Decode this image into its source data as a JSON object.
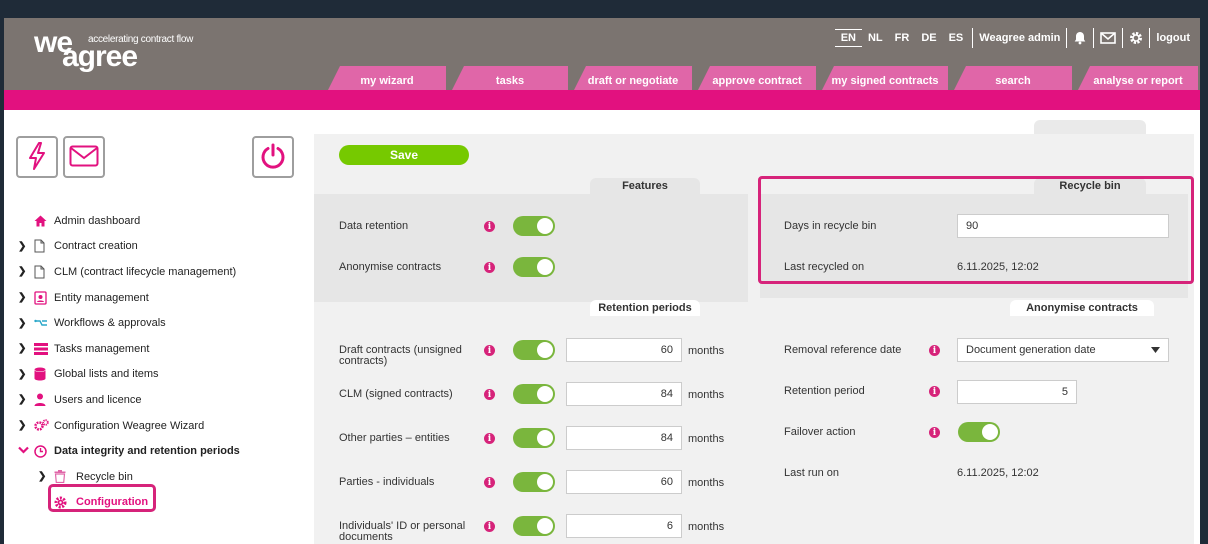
{
  "brand": {
    "we": "we",
    "agree": "agree",
    "tagline": "accelerating contract flow"
  },
  "languages": [
    {
      "code": "EN",
      "active": true
    },
    {
      "code": "NL",
      "active": false
    },
    {
      "code": "FR",
      "active": false
    },
    {
      "code": "DE",
      "active": false
    },
    {
      "code": "ES",
      "active": false
    }
  ],
  "user": {
    "name": "Weagree admin",
    "logout": "logout"
  },
  "nav_tabs": [
    "my wizard",
    "tasks",
    "draft or negotiate",
    "approve contract",
    "my signed contracts",
    "search",
    "analyse or report"
  ],
  "menu": [
    {
      "label": "Admin dashboard",
      "icon": "home-icon",
      "arrow": false
    },
    {
      "label": "Contract creation",
      "icon": "document-icon",
      "arrow": true
    },
    {
      "label": "CLM (contract lifecycle management)",
      "icon": "document-icon",
      "arrow": true
    },
    {
      "label": "Entity management",
      "icon": "contact-card-icon",
      "arrow": true
    },
    {
      "label": "Workflows & approvals",
      "icon": "workflow-icon",
      "arrow": true
    },
    {
      "label": "Tasks management",
      "icon": "list-icon",
      "arrow": true
    },
    {
      "label": "Global lists and items",
      "icon": "database-icon",
      "arrow": true
    },
    {
      "label": "Users and licence",
      "icon": "user-icon",
      "arrow": true
    },
    {
      "label": "Configuration Weagree Wizard",
      "icon": "gears-icon",
      "arrow": true
    },
    {
      "label": "Data integrity and retention periods",
      "icon": "clock-icon",
      "arrow": true,
      "expanded": true
    },
    {
      "label": "Recycle bin",
      "icon": "trash-icon",
      "arrow": true,
      "sub": true
    },
    {
      "label": "Configuration",
      "icon": "gear-icon",
      "arrow": false,
      "sub": true,
      "active": true
    }
  ],
  "save_label": "Save",
  "features": {
    "title": "Features",
    "rows": [
      {
        "label": "Data retention",
        "enabled": true
      },
      {
        "label": "Anonymise contracts",
        "enabled": true
      }
    ]
  },
  "retention": {
    "title": "Retention periods",
    "unit": "months",
    "rows": [
      {
        "label": "Draft contracts (unsigned contracts)",
        "value": "60",
        "enabled": true
      },
      {
        "label": "CLM (signed contracts)",
        "value": "84",
        "enabled": true
      },
      {
        "label": "Other parties – entities",
        "value": "84",
        "enabled": true
      },
      {
        "label": "Parties - individuals",
        "value": "60",
        "enabled": true
      },
      {
        "label": "Individuals' ID or personal documents",
        "value": "6",
        "enabled": true
      }
    ]
  },
  "recycle": {
    "title": "Recycle bin",
    "days_label": "Days in recycle bin",
    "days_value": "90",
    "last_label": "Last recycled on",
    "last_value": "6.11.2025, 12:02"
  },
  "anonymise": {
    "title": "Anonymise contracts",
    "ref_label": "Removal reference date",
    "ref_value": "Document generation date",
    "period_label": "Retention period",
    "period_value": "5",
    "failover_label": "Failover action",
    "failover_enabled": true,
    "lastrun_label": "Last run on",
    "lastrun_value": "6.11.2025, 12:02"
  },
  "colors": {
    "brand_pink": "#e2117f",
    "header_gray": "#7b7470",
    "toggle_green": "#7ab63d",
    "save_green": "#76c900",
    "highlight": "#d6237a"
  }
}
